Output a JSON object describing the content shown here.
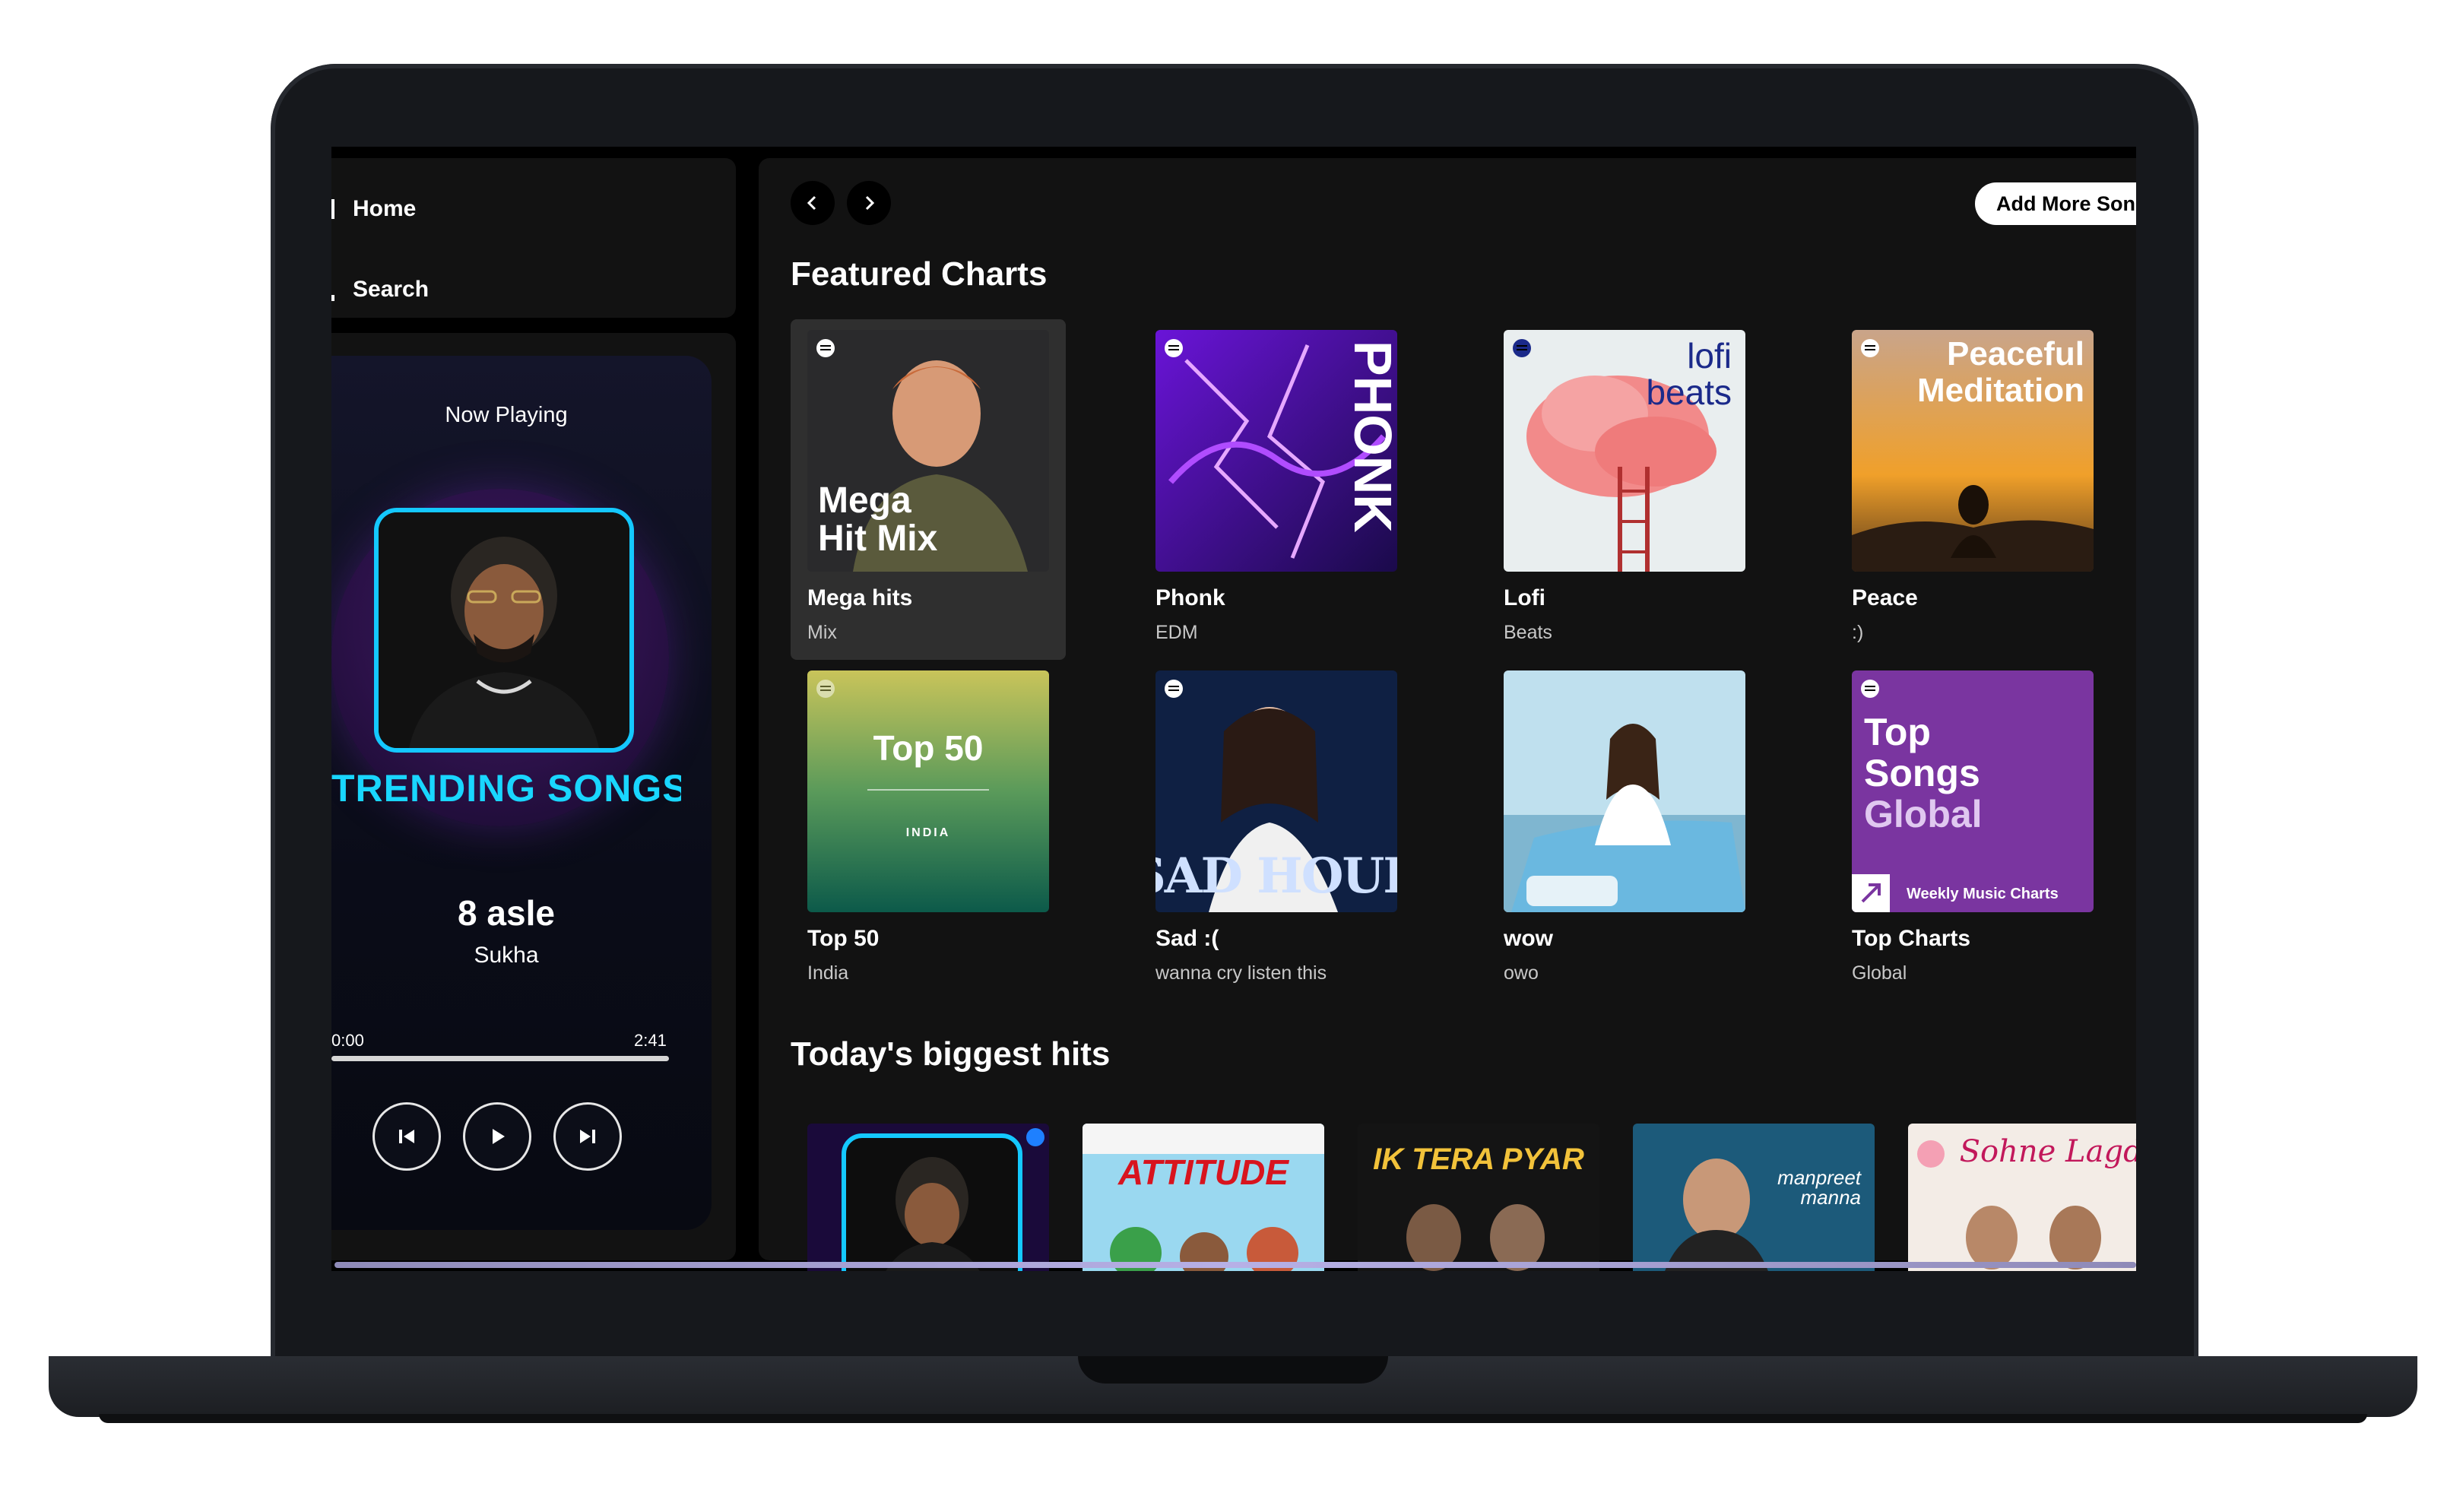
{
  "nav": {
    "home_label": "Home",
    "search_label": "Search"
  },
  "player": {
    "now_playing_label": "Now Playing",
    "banner_text": "TRENDING SONGS",
    "song_title": "8 asle",
    "artist": "Sukha",
    "time_elapsed": "0:00",
    "time_total": "2:41",
    "progress": 0.0
  },
  "header": {
    "add_button_label": "Add More Songs"
  },
  "featured": {
    "title": "Featured Charts",
    "cards": [
      {
        "title": "Mega hits",
        "subtitle": "Mix",
        "art_text": "Mega Hit Mix"
      },
      {
        "title": "Phonk",
        "subtitle": "EDM",
        "art_text": "PHONK"
      },
      {
        "title": "Lofi",
        "subtitle": "Beats",
        "art_text": "lofi beats"
      },
      {
        "title": "Peace",
        "subtitle": ":)",
        "art_text": "Peaceful Meditation"
      },
      {
        "title": "Top 50",
        "subtitle": "India",
        "art_text": "Top 50",
        "art_subtext": "INDIA"
      },
      {
        "title": "Sad :(",
        "subtitle": "wanna cry listen this",
        "art_text": "SAD HOUR"
      },
      {
        "title": "wow",
        "subtitle": "owo"
      },
      {
        "title": "Top Charts",
        "subtitle": "Global",
        "art_text": "Top Songs Global",
        "art_subtext": "Weekly Music Charts"
      }
    ]
  },
  "hits": {
    "title": "Today's biggest hits",
    "items": [
      {
        "art_text": ""
      },
      {
        "art_text": "ATTITUDE"
      },
      {
        "art_text": "IK TERA PYAR"
      },
      {
        "art_text": "manpreet manna"
      },
      {
        "art_text": "Sohne Lagde"
      }
    ]
  },
  "colors": {
    "accent_cyan": "#14c8ff",
    "panel": "#121212",
    "card_active": "#2f2f2f"
  }
}
